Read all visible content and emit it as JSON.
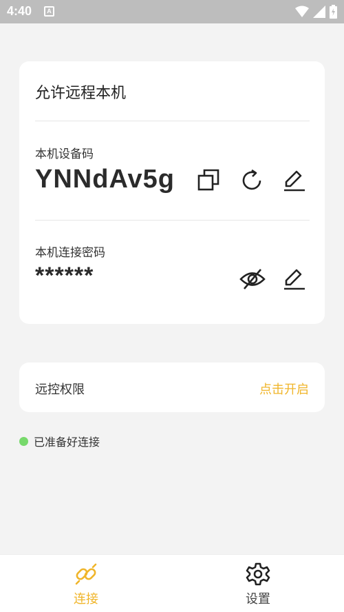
{
  "status_bar": {
    "time": "4:40",
    "notification_icon_letter": "A",
    "icons": [
      "wifi-icon",
      "signal-icon",
      "battery-icon"
    ]
  },
  "main_card": {
    "title": "允许远程本机",
    "device_code_label": "本机设备码",
    "device_code": "YNNdAv5g",
    "password_label": "本机连接密码",
    "password_mask": "******",
    "icons": [
      "copy-icon",
      "refresh-icon",
      "edit-icon",
      "eye-off-icon",
      "edit-icon"
    ]
  },
  "permission_card": {
    "label": "远控权限",
    "action": "点击开启"
  },
  "status": {
    "ready_text": "已准备好连接",
    "dot_color": "#77d96b"
  },
  "bottom_nav": {
    "items": [
      {
        "label": "连接",
        "icon": "link-icon",
        "active": true
      },
      {
        "label": "设置",
        "icon": "gear-icon",
        "active": false
      }
    ]
  },
  "colors": {
    "accent": "#f0b52a",
    "background": "#f3f3f3",
    "status_bar": "#bdbdbd"
  }
}
